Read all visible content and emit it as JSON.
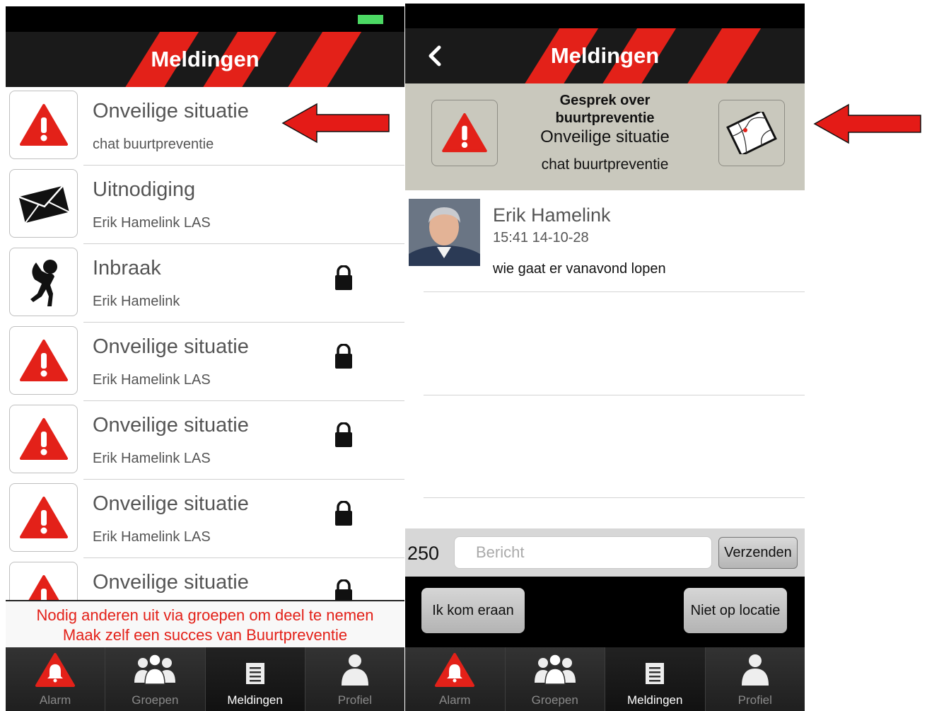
{
  "left": {
    "title": "Meldingen",
    "items": [
      {
        "title": "Onveilige situatie",
        "subtitle": "chat buurtpreventie",
        "icon": "warning-icon",
        "locked": false
      },
      {
        "title": "Uitnodiging",
        "subtitle": "Erik Hamelink LAS",
        "icon": "envelope-icon",
        "locked": false
      },
      {
        "title": "Inbraak",
        "subtitle": "Erik Hamelink",
        "icon": "burglar-icon",
        "locked": true
      },
      {
        "title": "Onveilige situatie",
        "subtitle": "Erik Hamelink LAS",
        "icon": "warning-icon",
        "locked": true
      },
      {
        "title": "Onveilige situatie",
        "subtitle": "Erik Hamelink LAS",
        "icon": "warning-icon",
        "locked": true
      },
      {
        "title": "Onveilige situatie",
        "subtitle": "Erik Hamelink LAS",
        "icon": "warning-icon",
        "locked": true
      },
      {
        "title": "Onveilige situatie",
        "subtitle": "",
        "icon": "warning-icon",
        "locked": true
      }
    ],
    "banner": {
      "line1": "Nodig anderen uit via groepen om deel te nemen",
      "line2": "Maak zelf een succes van Buurtpreventie"
    }
  },
  "right": {
    "title": "Meldingen",
    "header": {
      "line1": "Gesprek over buurtpreventie",
      "line2": "Onveilige situatie",
      "line3": "chat buurtpreventie"
    },
    "message": {
      "name": "Erik Hamelink",
      "time": "15:41  14-10-28",
      "text": "wie gaat er vanavond lopen"
    },
    "input": {
      "char_count": "250",
      "placeholder": "Bericht",
      "send_label": "Verzenden"
    },
    "actions": {
      "coming": "Ik kom eraan",
      "not_on_location": "Niet op locatie"
    }
  },
  "tabs": [
    "Alarm",
    "Groepen",
    "Meldingen",
    "Profiel"
  ],
  "active_tab": "Meldingen",
  "colors": {
    "accent_red": "#e32119",
    "navbar": "#1a1a1a",
    "header_bg": "#c9c8bd",
    "battery": "#4cd964"
  }
}
